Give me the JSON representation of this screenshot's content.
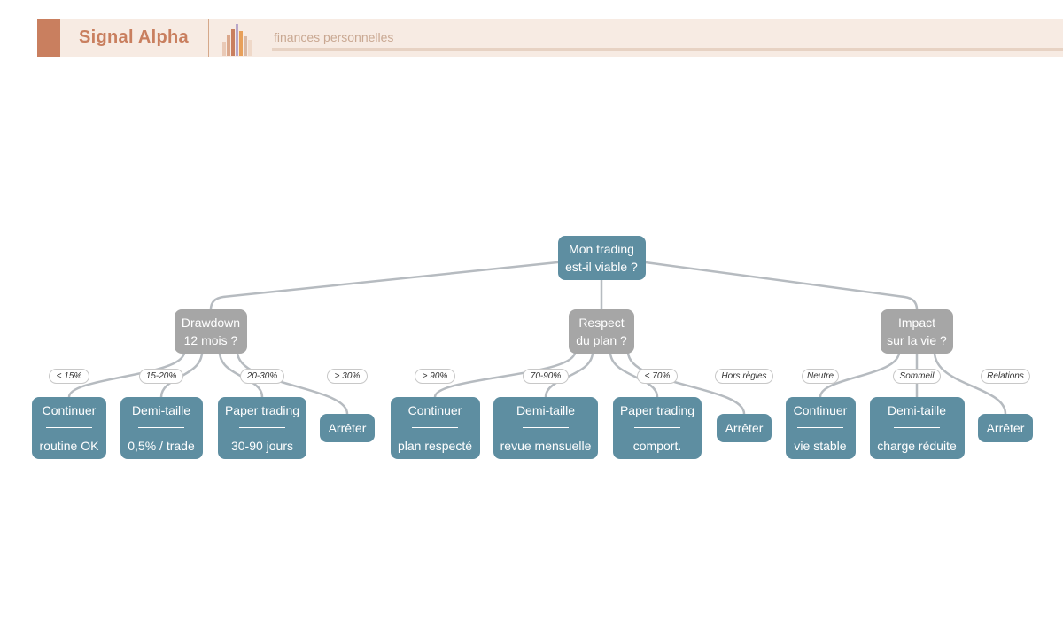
{
  "header": {
    "brand": "Signal Alpha",
    "tagline": "finances personnelles",
    "accent_color": "#c97f5f",
    "logo_icon": "bar-chart-icon"
  },
  "diagram": {
    "root": {
      "line1": "Mon trading",
      "line2": "est-il viable ?"
    },
    "branches": [
      {
        "question": {
          "line1": "Drawdown",
          "line2": "12 mois ?"
        },
        "options": [
          {
            "edge": "< 15%",
            "title": "Continuer",
            "detail": "routine OK"
          },
          {
            "edge": "15-20%",
            "title": "Demi-taille",
            "detail": "0,5% / trade"
          },
          {
            "edge": "20-30%",
            "title": "Paper trading",
            "detail": "30-90 jours"
          },
          {
            "edge": "> 30%",
            "title": "Arrêter"
          }
        ]
      },
      {
        "question": {
          "line1": "Respect",
          "line2": "du plan ?"
        },
        "options": [
          {
            "edge": "> 90%",
            "title": "Continuer",
            "detail": "plan respecté"
          },
          {
            "edge": "70-90%",
            "title": "Demi-taille",
            "detail": "revue mensuelle"
          },
          {
            "edge": "< 70%",
            "title": "Paper trading",
            "detail": "comport."
          },
          {
            "edge": "Hors règles",
            "title": "Arrêter"
          }
        ]
      },
      {
        "question": {
          "line1": "Impact",
          "line2": "sur la vie ?"
        },
        "options": [
          {
            "edge": "Neutre",
            "title": "Continuer",
            "detail": "vie stable"
          },
          {
            "edge": "Sommeil",
            "title": "Demi-taille",
            "detail": "charge réduite"
          },
          {
            "edge": "Relations",
            "title": "Arrêter"
          }
        ]
      }
    ],
    "colors": {
      "root": "#5e8ea1",
      "question": "#a6a6a6",
      "leaf": "#5e8ea1",
      "edge": "#b6bbc0"
    }
  }
}
